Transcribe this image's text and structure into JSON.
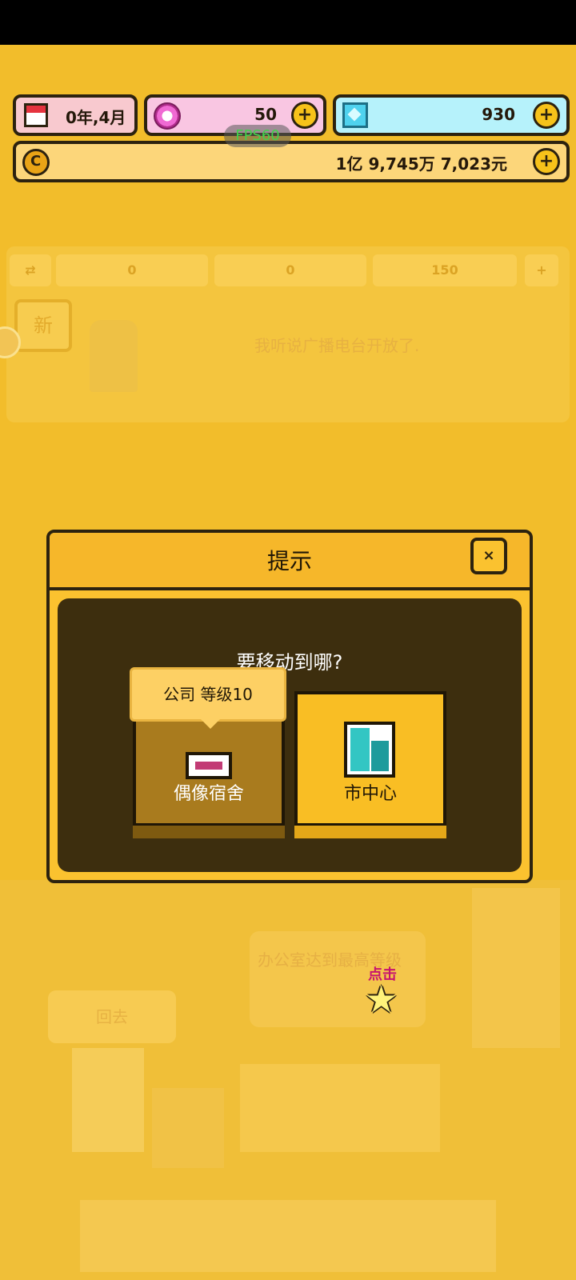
{
  "top_bar": {
    "date": "0年,4月",
    "gems": "50",
    "diamonds": "930",
    "money": "1亿 9,745万 7,023元",
    "fps": "FPS60"
  },
  "background": {
    "stats": [
      "0",
      "0",
      "150"
    ],
    "new_badge": "新",
    "message": "我听说广播电台开放了.",
    "back_label": "回去",
    "office_text": "办公室达到最高等级",
    "tap_label": "点击"
  },
  "dialog": {
    "title": "提示",
    "close_icon": "×",
    "question": "要移动到哪?",
    "options": [
      {
        "label": "偶像宿舍",
        "lock_text": "公司 等级10",
        "icon": "dorm-icon"
      },
      {
        "label": "市中心",
        "icon": "building-icon"
      }
    ]
  },
  "colors": {
    "background": "#f2bd2b",
    "dialog_body": "#3d2e0e",
    "accent": "#fbc22f"
  }
}
